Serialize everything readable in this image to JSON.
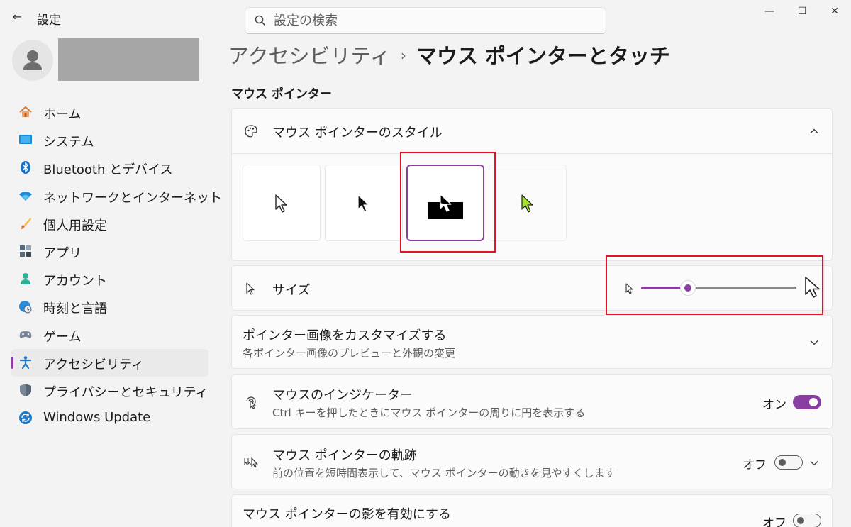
{
  "window": {
    "title": "設定",
    "minimize_glyph": "—",
    "maximize_glyph": "☐",
    "close_glyph": "✕",
    "back_glyph": "←"
  },
  "search": {
    "placeholder": "設定の検索"
  },
  "sidebar": {
    "items": [
      {
        "label": "ホーム",
        "icon": "home-icon"
      },
      {
        "label": "システム",
        "icon": "system-icon"
      },
      {
        "label": "Bluetooth とデバイス",
        "icon": "bluetooth-icon"
      },
      {
        "label": "ネットワークとインターネット",
        "icon": "wifi-icon"
      },
      {
        "label": "個人用設定",
        "icon": "brush-icon"
      },
      {
        "label": "アプリ",
        "icon": "apps-icon"
      },
      {
        "label": "アカウント",
        "icon": "account-icon"
      },
      {
        "label": "時刻と言語",
        "icon": "globe-clock-icon"
      },
      {
        "label": "ゲーム",
        "icon": "gamepad-icon"
      },
      {
        "label": "アクセシビリティ",
        "icon": "accessibility-icon",
        "active": true
      },
      {
        "label": "プライバシーとセキュリティ",
        "icon": "shield-icon"
      },
      {
        "label": "Windows Update",
        "icon": "update-icon"
      }
    ]
  },
  "breadcrumb": {
    "parent": "アクセシビリティ",
    "separator": "›",
    "current": "マウス ポインターとタッチ"
  },
  "section": {
    "title": "マウス ポインター"
  },
  "pointer_style": {
    "title": "マウス ポインターのスタイル",
    "options": [
      "white",
      "black",
      "inverted",
      "custom"
    ],
    "selected": "inverted",
    "custom_color": "#a6e22e"
  },
  "size": {
    "title": "サイズ",
    "level_fraction": 0.3
  },
  "customize": {
    "title": "ポインター画像をカスタマイズする",
    "subtitle": "各ポインター画像のプレビューと外観の変更"
  },
  "indicator": {
    "title": "マウスのインジケーター",
    "subtitle": "Ctrl キーを押したときにマウス ポインターの周りに円を表示する",
    "state": "オン"
  },
  "trails": {
    "title": "マウス ポインターの軌跡",
    "subtitle": "前の位置を短時間表示して、マウス ポインターの動きを見やすくします",
    "state": "オフ"
  },
  "shadow": {
    "title": "マウス ポインターの影を有効にする",
    "state": "オフ"
  },
  "colors": {
    "accent": "#8a3fa0",
    "highlight": "#e81123"
  }
}
